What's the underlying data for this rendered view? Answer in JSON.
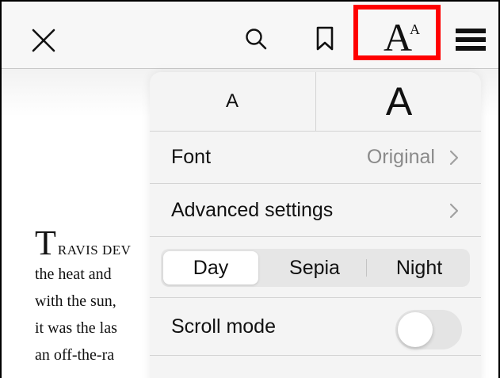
{
  "toolbar": {
    "close_icon": "close-icon",
    "search_icon": "search-icon",
    "bookmark_icon": "bookmark-icon",
    "font_size_icon": {
      "big": "A",
      "small": "A"
    },
    "menu_icon": "menu-icon",
    "highlight_color": "#ff0000"
  },
  "book": {
    "drop_cap": "T",
    "first_line_rest": "RAVIS DEV",
    "lines": [
      "the heat and",
      "with the sun,",
      "it was the las",
      "an off-the-ra"
    ]
  },
  "popover": {
    "size_small": "A",
    "size_large": "A",
    "font_label": "Font",
    "font_value": "Original",
    "advanced_label": "Advanced settings",
    "themes": {
      "day": "Day",
      "sepia": "Sepia",
      "night": "Night",
      "selected": "Day"
    },
    "scroll_label": "Scroll mode",
    "scroll_enabled": false
  }
}
